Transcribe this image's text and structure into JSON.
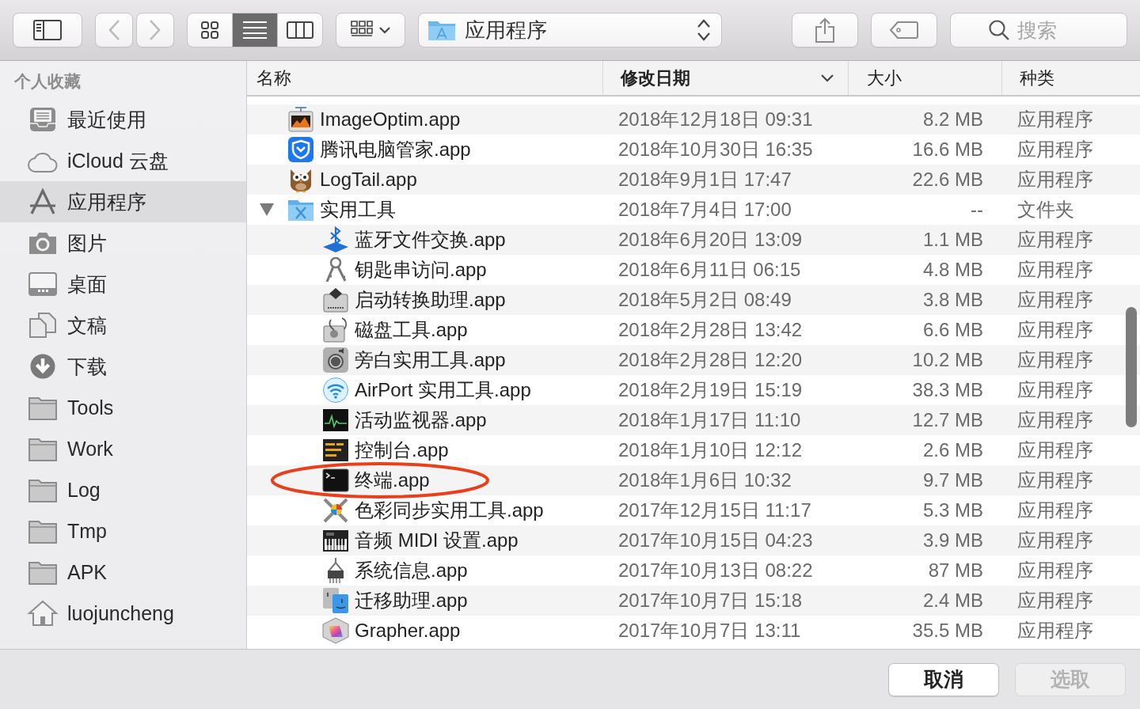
{
  "toolbar": {
    "navigation": [
      {
        "kind": "back",
        "disabled": true
      },
      {
        "kind": "forward",
        "disabled": true
      }
    ],
    "view_modes": [
      {
        "kind": "icons",
        "selected": false
      },
      {
        "kind": "list",
        "selected": true
      },
      {
        "kind": "columns",
        "selected": false
      }
    ],
    "path": {
      "label": "应用程序"
    },
    "search": {
      "placeholder": "搜索"
    }
  },
  "sidebar": {
    "section": "个人收藏",
    "items": [
      {
        "label": "最近使用",
        "kind": "recents",
        "selected": false
      },
      {
        "label": "iCloud 云盘",
        "kind": "cloud",
        "selected": false
      },
      {
        "label": "应用程序",
        "kind": "apps",
        "selected": true
      },
      {
        "label": "图片",
        "kind": "pictures",
        "selected": false
      },
      {
        "label": "桌面",
        "kind": "desktop",
        "selected": false
      },
      {
        "label": "文稿",
        "kind": "documents",
        "selected": false
      },
      {
        "label": "下载",
        "kind": "downloads",
        "selected": false
      },
      {
        "label": "Tools",
        "kind": "folder",
        "selected": false
      },
      {
        "label": "Work",
        "kind": "folder",
        "selected": false
      },
      {
        "label": "Log",
        "kind": "folder",
        "selected": false
      },
      {
        "label": "Tmp",
        "kind": "folder",
        "selected": false
      },
      {
        "label": "APK",
        "kind": "folder",
        "selected": false
      },
      {
        "label": "luojuncheng",
        "kind": "home",
        "selected": false
      }
    ]
  },
  "table": {
    "columns": [
      {
        "label": "名称",
        "sorted": false
      },
      {
        "label": "修改日期",
        "sorted": true
      },
      {
        "label": "大小",
        "sorted": false
      },
      {
        "label": "种类",
        "sorted": false
      }
    ],
    "rows": [
      {
        "name": "ImageOptim.app",
        "kind": "photo",
        "modified": "2018年12月18日 09:31",
        "size": "8.2 MB",
        "category": "应用程序",
        "selected": false,
        "circled": false
      },
      {
        "name": "腾讯电脑管家.app",
        "kind": "shield",
        "modified": "2018年10月30日 16:35",
        "size": "16.6 MB",
        "category": "应用程序",
        "selected": false,
        "circled": false
      },
      {
        "name": "LogTail.app",
        "kind": "owl",
        "modified": "2018年9月1日 17:47",
        "size": "22.6 MB",
        "category": "应用程序",
        "selected": false,
        "circled": false
      },
      {
        "name": "实用工具",
        "kind": "folder",
        "modified": "2018年7月4日 17:00",
        "size": "--",
        "category": "文件夹",
        "selected": false,
        "circled": false,
        "expanded": true,
        "children": [
          {
            "name": "蓝牙文件交换.app",
            "kind": "bluetooth",
            "modified": "2018年6月20日 13:09",
            "size": "1.1 MB",
            "category": "应用程序",
            "selected": false,
            "circled": false
          },
          {
            "name": "钥匙串访问.app",
            "kind": "keys",
            "modified": "2018年6月11日 06:15",
            "size": "4.8 MB",
            "category": "应用程序",
            "selected": false,
            "circled": false
          },
          {
            "name": "启动转换助理.app",
            "kind": "drive",
            "modified": "2018年5月2日 08:49",
            "size": "3.8 MB",
            "category": "应用程序",
            "selected": false,
            "circled": false
          },
          {
            "name": "磁盘工具.app",
            "kind": "stethoscope",
            "modified": "2018年2月28日 13:42",
            "size": "6.6 MB",
            "category": "应用程序",
            "selected": false,
            "circled": false
          },
          {
            "name": "旁白实用工具.app",
            "kind": "speaker",
            "modified": "2018年2月28日 12:20",
            "size": "10.2 MB",
            "category": "应用程序",
            "selected": false,
            "circled": false
          },
          {
            "name": "AirPort 实用工具.app",
            "kind": "wifi",
            "modified": "2018年2月19日 15:19",
            "size": "38.3 MB",
            "category": "应用程序",
            "selected": false,
            "circled": false
          },
          {
            "name": "活动监视器.app",
            "kind": "monitor",
            "modified": "2018年1月17日 11:10",
            "size": "12.7 MB",
            "category": "应用程序",
            "selected": false,
            "circled": false
          },
          {
            "name": "控制台.app",
            "kind": "console",
            "modified": "2018年1月10日 12:12",
            "size": "2.6 MB",
            "category": "应用程序",
            "selected": false,
            "circled": false
          },
          {
            "name": "终端.app",
            "kind": "terminal",
            "modified": "2018年1月6日 10:32",
            "size": "9.7 MB",
            "category": "应用程序",
            "selected": false,
            "circled": true
          },
          {
            "name": "色彩同步实用工具.app",
            "kind": "calipers",
            "modified": "2017年12月15日 11:17",
            "size": "5.3 MB",
            "category": "应用程序",
            "selected": false,
            "circled": false
          },
          {
            "name": "音频 MIDI 设置.app",
            "kind": "piano",
            "modified": "2017年10月15日 04:23",
            "size": "3.9 MB",
            "category": "应用程序",
            "selected": false,
            "circled": false
          },
          {
            "name": "系统信息.app",
            "kind": "chip",
            "modified": "2017年10月13日 08:22",
            "size": "87 MB",
            "category": "应用程序",
            "selected": false,
            "circled": false
          },
          {
            "name": "迁移助理.app",
            "kind": "migration",
            "modified": "2017年10月7日 15:18",
            "size": "2.4 MB",
            "category": "应用程序",
            "selected": false,
            "circled": false
          },
          {
            "name": "Grapher.app",
            "kind": "graph",
            "modified": "2017年10月7日 13:11",
            "size": "35.5 MB",
            "category": "应用程序",
            "selected": false,
            "circled": false
          }
        ]
      }
    ]
  },
  "dialog_buttons": [
    {
      "label": "取消",
      "disabled": false
    },
    {
      "label": "选取",
      "disabled": true
    }
  ]
}
